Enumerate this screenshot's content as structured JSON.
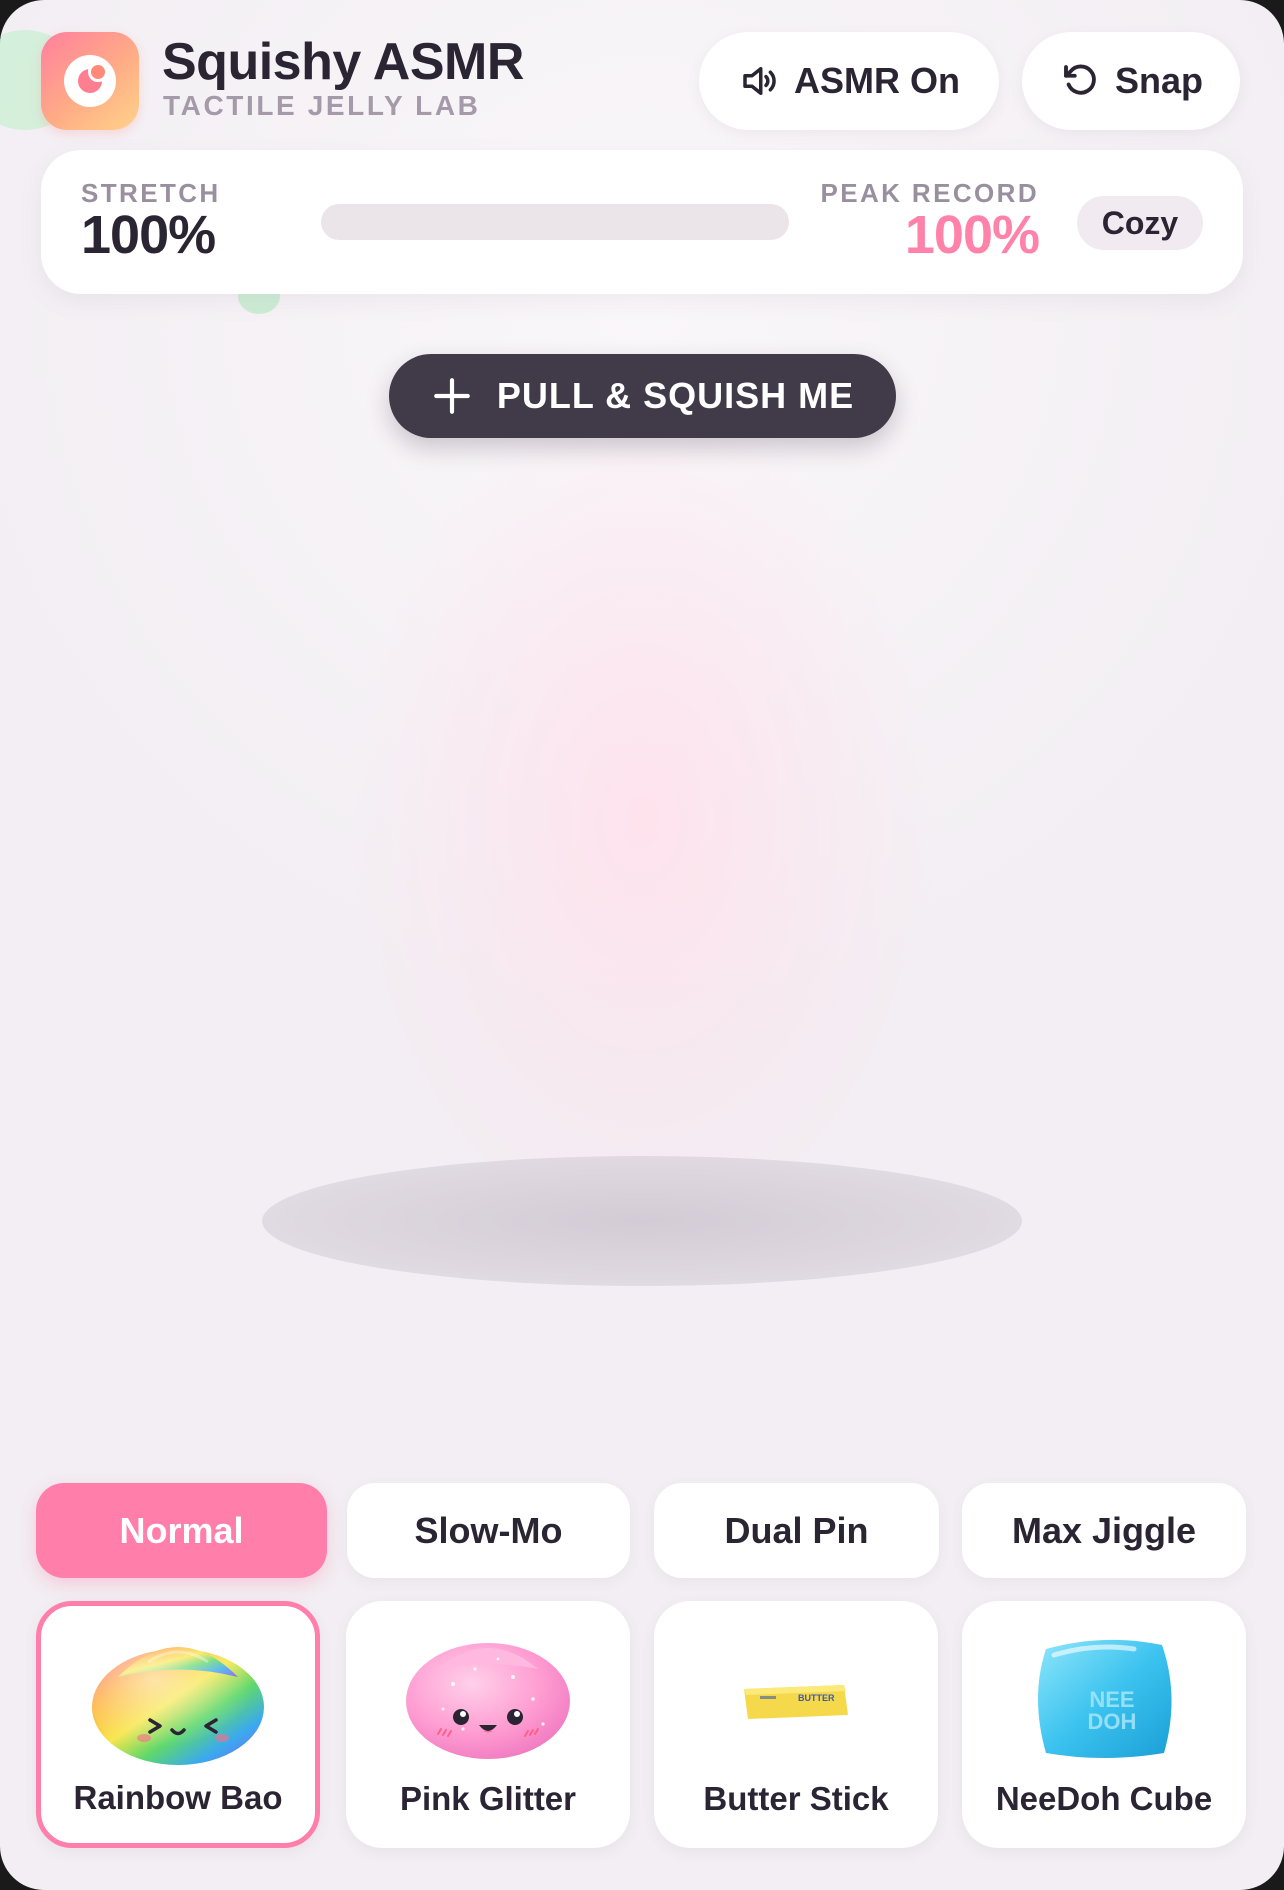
{
  "header": {
    "title": "Squishy ASMR",
    "subtitle": "TACTILE JELLY LAB",
    "asmr_label": "ASMR On",
    "snap_label": "Snap"
  },
  "stats": {
    "stretch_label": "STRETCH",
    "stretch_value": "100%",
    "stretch_bar_fraction": 0.0,
    "peak_label": "PEAK RECORD",
    "peak_value": "100%",
    "mood_badge": "Cozy"
  },
  "action": {
    "pull_label": "PULL & SQUISH ME"
  },
  "modes": [
    {
      "label": "Normal",
      "active": true
    },
    {
      "label": "Slow-Mo",
      "active": false
    },
    {
      "label": "Dual Pin",
      "active": false
    },
    {
      "label": "Max Jiggle",
      "active": false
    }
  ],
  "toys": [
    {
      "name": "Rainbow Bao",
      "icon": "rainbow-bao-icon",
      "active": true
    },
    {
      "name": "Pink Glitter",
      "icon": "pink-glitter-bao-icon",
      "active": false
    },
    {
      "name": "Butter Stick",
      "icon": "butter-stick-icon",
      "active": false,
      "label_text": "BUTTER"
    },
    {
      "name": "NeeDoh Cube",
      "icon": "needoh-cube-icon",
      "active": false,
      "label_text": "NEE DOH"
    }
  ],
  "colors": {
    "accent": "#ff7faa",
    "dark_button": "#413a48",
    "peak": "#ff82ab"
  }
}
